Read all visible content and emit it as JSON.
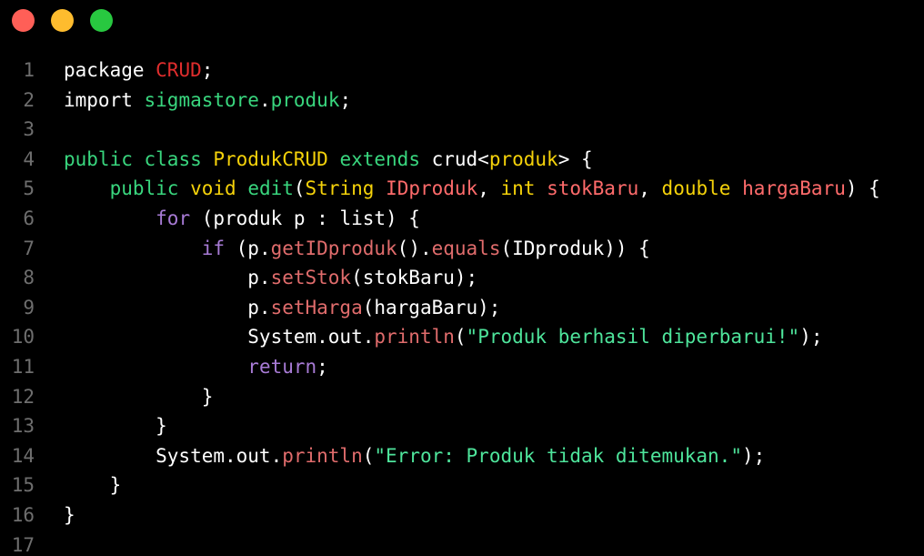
{
  "window": {
    "buttons": {
      "close_color": "#ff5f57",
      "minimize_color": "#febc2e",
      "maximize_color": "#28c840"
    }
  },
  "theme": {
    "plain": "#ffffff",
    "line_number": "#6e6e6e",
    "keyword_green": "#39d67e",
    "keyword_purple": "#a87bd6",
    "type_yellow": "#f5d20a",
    "param_red": "#ff6b6b",
    "method_red": "#e06c6c",
    "string_green": "#4ee49b",
    "package_red": "#e02d2d"
  },
  "lines": [
    {
      "n": "1",
      "tokens": [
        {
          "t": "package ",
          "c": "plain"
        },
        {
          "t": "CRUD",
          "c": "package_red"
        },
        {
          "t": ";",
          "c": "plain"
        }
      ]
    },
    {
      "n": "2",
      "tokens": [
        {
          "t": "import ",
          "c": "plain"
        },
        {
          "t": "sigmastore",
          "c": "keyword_green"
        },
        {
          "t": ".",
          "c": "plain"
        },
        {
          "t": "produk",
          "c": "keyword_green"
        },
        {
          "t": ";",
          "c": "plain"
        }
      ]
    },
    {
      "n": "3",
      "tokens": []
    },
    {
      "n": "4",
      "tokens": [
        {
          "t": "public ",
          "c": "keyword_green"
        },
        {
          "t": "class ",
          "c": "keyword_green"
        },
        {
          "t": "ProdukCRUD",
          "c": "type_yellow"
        },
        {
          "t": " extends ",
          "c": "keyword_green"
        },
        {
          "t": "crud<",
          "c": "plain"
        },
        {
          "t": "produk",
          "c": "type_yellow"
        },
        {
          "t": "> {",
          "c": "plain"
        }
      ]
    },
    {
      "n": "5",
      "tokens": [
        {
          "t": "    ",
          "c": "plain"
        },
        {
          "t": "public ",
          "c": "keyword_green"
        },
        {
          "t": "void ",
          "c": "type_yellow"
        },
        {
          "t": "edit",
          "c": "keyword_green"
        },
        {
          "t": "(",
          "c": "plain"
        },
        {
          "t": "String ",
          "c": "type_yellow"
        },
        {
          "t": "IDproduk",
          "c": "param_red"
        },
        {
          "t": ", ",
          "c": "plain"
        },
        {
          "t": "int ",
          "c": "type_yellow"
        },
        {
          "t": "stokBaru",
          "c": "param_red"
        },
        {
          "t": ", ",
          "c": "plain"
        },
        {
          "t": "double ",
          "c": "type_yellow"
        },
        {
          "t": "hargaBaru",
          "c": "param_red"
        },
        {
          "t": ") {",
          "c": "plain"
        }
      ]
    },
    {
      "n": "6",
      "tokens": [
        {
          "t": "        ",
          "c": "plain"
        },
        {
          "t": "for",
          "c": "keyword_purple"
        },
        {
          "t": " (produk p : list) {",
          "c": "plain"
        }
      ]
    },
    {
      "n": "7",
      "tokens": [
        {
          "t": "            ",
          "c": "plain"
        },
        {
          "t": "if",
          "c": "keyword_purple"
        },
        {
          "t": " (p.",
          "c": "plain"
        },
        {
          "t": "getIDproduk",
          "c": "method_red"
        },
        {
          "t": "().",
          "c": "plain"
        },
        {
          "t": "equals",
          "c": "method_red"
        },
        {
          "t": "(IDproduk)) {",
          "c": "plain"
        }
      ]
    },
    {
      "n": "8",
      "tokens": [
        {
          "t": "                p.",
          "c": "plain"
        },
        {
          "t": "setStok",
          "c": "method_red"
        },
        {
          "t": "(stokBaru);",
          "c": "plain"
        }
      ]
    },
    {
      "n": "9",
      "tokens": [
        {
          "t": "                p.",
          "c": "plain"
        },
        {
          "t": "setHarga",
          "c": "method_red"
        },
        {
          "t": "(hargaBaru);",
          "c": "plain"
        }
      ]
    },
    {
      "n": "10",
      "tokens": [
        {
          "t": "                System.out.",
          "c": "plain"
        },
        {
          "t": "println",
          "c": "method_red"
        },
        {
          "t": "(",
          "c": "plain"
        },
        {
          "t": "\"Produk berhasil diperbarui!\"",
          "c": "string_green"
        },
        {
          "t": ");",
          "c": "plain"
        }
      ]
    },
    {
      "n": "11",
      "tokens": [
        {
          "t": "                ",
          "c": "plain"
        },
        {
          "t": "return",
          "c": "keyword_purple"
        },
        {
          "t": ";",
          "c": "plain"
        }
      ]
    },
    {
      "n": "12",
      "tokens": [
        {
          "t": "            }",
          "c": "plain"
        }
      ]
    },
    {
      "n": "13",
      "tokens": [
        {
          "t": "        }",
          "c": "plain"
        }
      ]
    },
    {
      "n": "14",
      "tokens": [
        {
          "t": "        System.out.",
          "c": "plain"
        },
        {
          "t": "println",
          "c": "method_red"
        },
        {
          "t": "(",
          "c": "plain"
        },
        {
          "t": "\"Error: Produk tidak ditemukan.\"",
          "c": "string_green"
        },
        {
          "t": ");",
          "c": "plain"
        }
      ]
    },
    {
      "n": "15",
      "tokens": [
        {
          "t": "    }",
          "c": "plain"
        }
      ]
    },
    {
      "n": "16",
      "tokens": [
        {
          "t": "}",
          "c": "plain"
        }
      ]
    },
    {
      "n": "17",
      "tokens": []
    }
  ]
}
